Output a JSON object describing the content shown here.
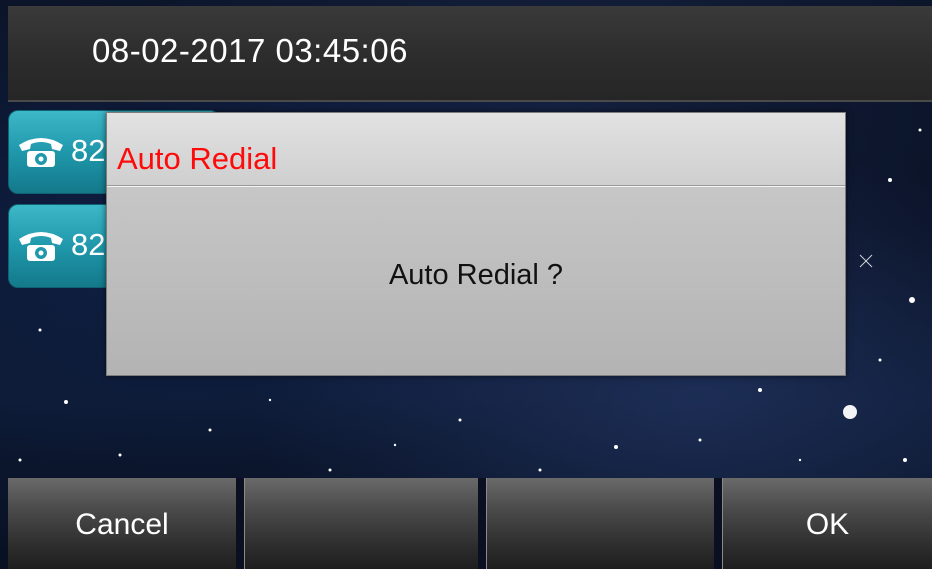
{
  "status_bar": {
    "datetime": "08-02-2017 03:45:06"
  },
  "line_keys": [
    {
      "icon": "phone-icon",
      "label": "82"
    },
    {
      "icon": "phone-icon",
      "label": "82"
    }
  ],
  "dialog": {
    "title": "Auto Redial",
    "message": "Auto Redial ?",
    "title_color": "#ff0a0a"
  },
  "softkeys": [
    {
      "label": "Cancel"
    },
    {
      "label": ""
    },
    {
      "label": ""
    },
    {
      "label": "OK"
    }
  ],
  "colors": {
    "line_key": "#1f98ab",
    "status_bar": "#2c2c2c"
  }
}
